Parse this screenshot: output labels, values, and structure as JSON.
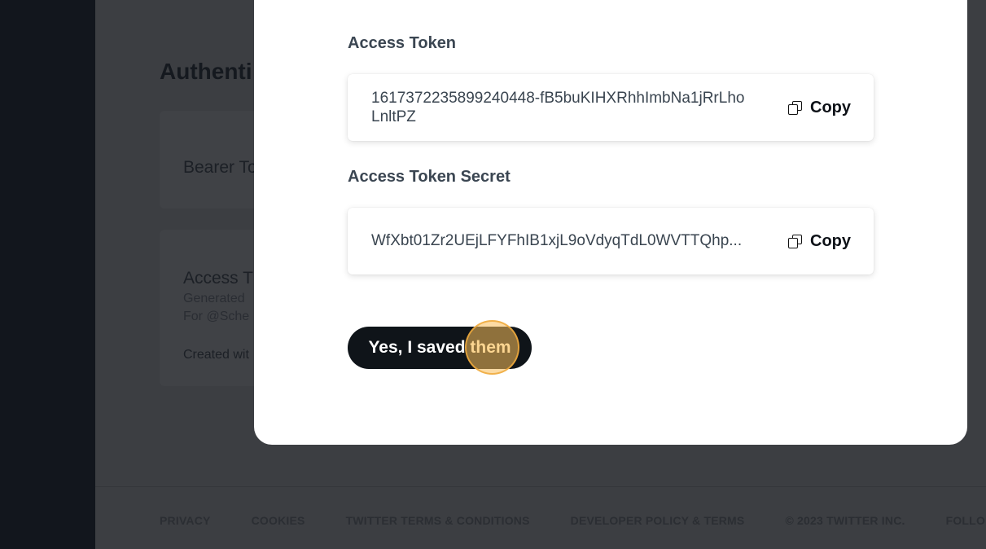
{
  "background": {
    "heading": "Authenti",
    "cards": {
      "bearer_label": "Bearer To",
      "access_label": "Access T",
      "generated_line": "Generated",
      "for_line": "For @Sche",
      "created_line": "Created wit"
    }
  },
  "footer": {
    "links": [
      "PRIVACY",
      "COOKIES",
      "TWITTER TERMS & CONDITIONS",
      "DEVELOPER POLICY & TERMS",
      "© 2023 TWITTER INC.",
      "FOLLO"
    ]
  },
  "modal": {
    "access_token": {
      "label": "Access Token",
      "value": "1617372235899240448-fB5buKIHXRhhImbNa1jRrLhoLnltPZ",
      "copy_label": "Copy"
    },
    "access_token_secret": {
      "label": "Access Token Secret",
      "value": "WfXbt01Zr2UEjLFYFhIB1xjL9oVdyqTdL0WVTTQhp...",
      "copy_label": "Copy"
    },
    "confirm_button": {
      "label_main": "Yes, I saved",
      "label_highlight": "them"
    }
  },
  "colors": {
    "accent_dark": "#0f1419",
    "overlay": "#3c3e42",
    "sidebar": "#12161d",
    "click_marker": "#fabe5a"
  }
}
